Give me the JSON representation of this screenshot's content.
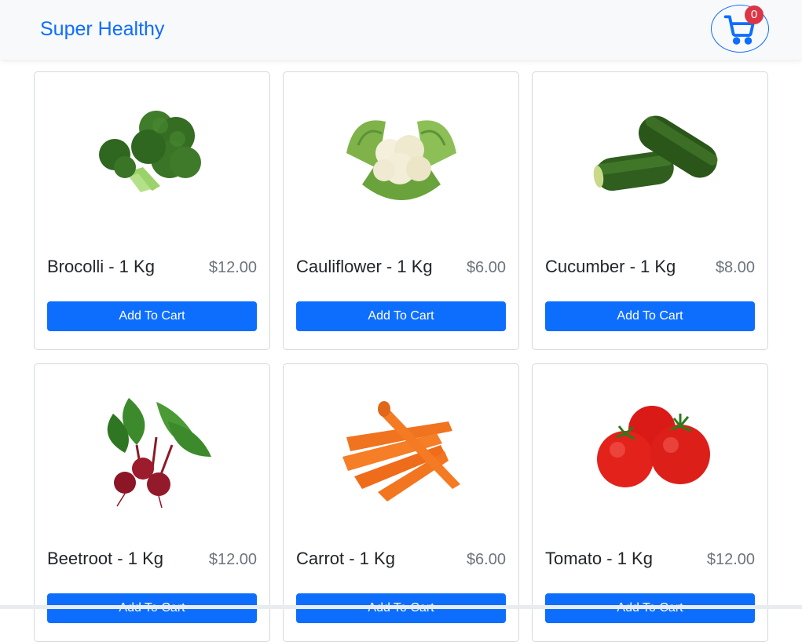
{
  "navbar": {
    "brand": "Super Healthy",
    "cart_count": "0"
  },
  "products": [
    {
      "name": "Brocolli - 1 Kg",
      "price": "$12.00",
      "button": "Add To Cart",
      "image_icon": "broccoli-icon"
    },
    {
      "name": "Cauliflower - 1 Kg",
      "price": "$6.00",
      "button": "Add To Cart",
      "image_icon": "cauliflower-icon"
    },
    {
      "name": "Cucumber - 1 Kg",
      "price": "$8.00",
      "button": "Add To Cart",
      "image_icon": "cucumber-icon"
    },
    {
      "name": "Beetroot - 1 Kg",
      "price": "$12.00",
      "button": "Add To Cart",
      "image_icon": "beetroot-icon"
    },
    {
      "name": "Carrot - 1 Kg",
      "price": "$6.00",
      "button": "Add To Cart",
      "image_icon": "carrot-icon"
    },
    {
      "name": "Tomato - 1 Kg",
      "price": "$12.00",
      "button": "Add To Cart",
      "image_icon": "tomato-icon"
    }
  ],
  "colors": {
    "primary": "#0d6efd",
    "badge": "#dc3545",
    "navbar_bg": "#f8f9fa",
    "price": "#6c757d"
  }
}
